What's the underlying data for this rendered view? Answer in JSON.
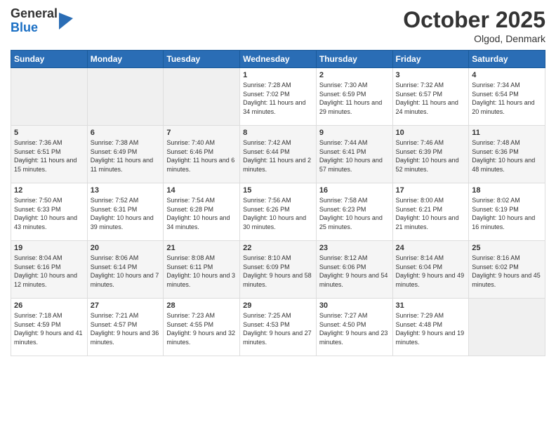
{
  "logo": {
    "general": "General",
    "blue": "Blue"
  },
  "header": {
    "month": "October 2025",
    "location": "Olgod, Denmark"
  },
  "weekdays": [
    "Sunday",
    "Monday",
    "Tuesday",
    "Wednesday",
    "Thursday",
    "Friday",
    "Saturday"
  ],
  "weeks": [
    [
      {
        "day": "",
        "sunrise": "",
        "sunset": "",
        "daylight": ""
      },
      {
        "day": "",
        "sunrise": "",
        "sunset": "",
        "daylight": ""
      },
      {
        "day": "",
        "sunrise": "",
        "sunset": "",
        "daylight": ""
      },
      {
        "day": "1",
        "sunrise": "Sunrise: 7:28 AM",
        "sunset": "Sunset: 7:02 PM",
        "daylight": "Daylight: 11 hours and 34 minutes."
      },
      {
        "day": "2",
        "sunrise": "Sunrise: 7:30 AM",
        "sunset": "Sunset: 6:59 PM",
        "daylight": "Daylight: 11 hours and 29 minutes."
      },
      {
        "day": "3",
        "sunrise": "Sunrise: 7:32 AM",
        "sunset": "Sunset: 6:57 PM",
        "daylight": "Daylight: 11 hours and 24 minutes."
      },
      {
        "day": "4",
        "sunrise": "Sunrise: 7:34 AM",
        "sunset": "Sunset: 6:54 PM",
        "daylight": "Daylight: 11 hours and 20 minutes."
      }
    ],
    [
      {
        "day": "5",
        "sunrise": "Sunrise: 7:36 AM",
        "sunset": "Sunset: 6:51 PM",
        "daylight": "Daylight: 11 hours and 15 minutes."
      },
      {
        "day": "6",
        "sunrise": "Sunrise: 7:38 AM",
        "sunset": "Sunset: 6:49 PM",
        "daylight": "Daylight: 11 hours and 11 minutes."
      },
      {
        "day": "7",
        "sunrise": "Sunrise: 7:40 AM",
        "sunset": "Sunset: 6:46 PM",
        "daylight": "Daylight: 11 hours and 6 minutes."
      },
      {
        "day": "8",
        "sunrise": "Sunrise: 7:42 AM",
        "sunset": "Sunset: 6:44 PM",
        "daylight": "Daylight: 11 hours and 2 minutes."
      },
      {
        "day": "9",
        "sunrise": "Sunrise: 7:44 AM",
        "sunset": "Sunset: 6:41 PM",
        "daylight": "Daylight: 10 hours and 57 minutes."
      },
      {
        "day": "10",
        "sunrise": "Sunrise: 7:46 AM",
        "sunset": "Sunset: 6:39 PM",
        "daylight": "Daylight: 10 hours and 52 minutes."
      },
      {
        "day": "11",
        "sunrise": "Sunrise: 7:48 AM",
        "sunset": "Sunset: 6:36 PM",
        "daylight": "Daylight: 10 hours and 48 minutes."
      }
    ],
    [
      {
        "day": "12",
        "sunrise": "Sunrise: 7:50 AM",
        "sunset": "Sunset: 6:33 PM",
        "daylight": "Daylight: 10 hours and 43 minutes."
      },
      {
        "day": "13",
        "sunrise": "Sunrise: 7:52 AM",
        "sunset": "Sunset: 6:31 PM",
        "daylight": "Daylight: 10 hours and 39 minutes."
      },
      {
        "day": "14",
        "sunrise": "Sunrise: 7:54 AM",
        "sunset": "Sunset: 6:28 PM",
        "daylight": "Daylight: 10 hours and 34 minutes."
      },
      {
        "day": "15",
        "sunrise": "Sunrise: 7:56 AM",
        "sunset": "Sunset: 6:26 PM",
        "daylight": "Daylight: 10 hours and 30 minutes."
      },
      {
        "day": "16",
        "sunrise": "Sunrise: 7:58 AM",
        "sunset": "Sunset: 6:23 PM",
        "daylight": "Daylight: 10 hours and 25 minutes."
      },
      {
        "day": "17",
        "sunrise": "Sunrise: 8:00 AM",
        "sunset": "Sunset: 6:21 PM",
        "daylight": "Daylight: 10 hours and 21 minutes."
      },
      {
        "day": "18",
        "sunrise": "Sunrise: 8:02 AM",
        "sunset": "Sunset: 6:19 PM",
        "daylight": "Daylight: 10 hours and 16 minutes."
      }
    ],
    [
      {
        "day": "19",
        "sunrise": "Sunrise: 8:04 AM",
        "sunset": "Sunset: 6:16 PM",
        "daylight": "Daylight: 10 hours and 12 minutes."
      },
      {
        "day": "20",
        "sunrise": "Sunrise: 8:06 AM",
        "sunset": "Sunset: 6:14 PM",
        "daylight": "Daylight: 10 hours and 7 minutes."
      },
      {
        "day": "21",
        "sunrise": "Sunrise: 8:08 AM",
        "sunset": "Sunset: 6:11 PM",
        "daylight": "Daylight: 10 hours and 3 minutes."
      },
      {
        "day": "22",
        "sunrise": "Sunrise: 8:10 AM",
        "sunset": "Sunset: 6:09 PM",
        "daylight": "Daylight: 9 hours and 58 minutes."
      },
      {
        "day": "23",
        "sunrise": "Sunrise: 8:12 AM",
        "sunset": "Sunset: 6:06 PM",
        "daylight": "Daylight: 9 hours and 54 minutes."
      },
      {
        "day": "24",
        "sunrise": "Sunrise: 8:14 AM",
        "sunset": "Sunset: 6:04 PM",
        "daylight": "Daylight: 9 hours and 49 minutes."
      },
      {
        "day": "25",
        "sunrise": "Sunrise: 8:16 AM",
        "sunset": "Sunset: 6:02 PM",
        "daylight": "Daylight: 9 hours and 45 minutes."
      }
    ],
    [
      {
        "day": "26",
        "sunrise": "Sunrise: 7:18 AM",
        "sunset": "Sunset: 4:59 PM",
        "daylight": "Daylight: 9 hours and 41 minutes."
      },
      {
        "day": "27",
        "sunrise": "Sunrise: 7:21 AM",
        "sunset": "Sunset: 4:57 PM",
        "daylight": "Daylight: 9 hours and 36 minutes."
      },
      {
        "day": "28",
        "sunrise": "Sunrise: 7:23 AM",
        "sunset": "Sunset: 4:55 PM",
        "daylight": "Daylight: 9 hours and 32 minutes."
      },
      {
        "day": "29",
        "sunrise": "Sunrise: 7:25 AM",
        "sunset": "Sunset: 4:53 PM",
        "daylight": "Daylight: 9 hours and 27 minutes."
      },
      {
        "day": "30",
        "sunrise": "Sunrise: 7:27 AM",
        "sunset": "Sunset: 4:50 PM",
        "daylight": "Daylight: 9 hours and 23 minutes."
      },
      {
        "day": "31",
        "sunrise": "Sunrise: 7:29 AM",
        "sunset": "Sunset: 4:48 PM",
        "daylight": "Daylight: 9 hours and 19 minutes."
      },
      {
        "day": "",
        "sunrise": "",
        "sunset": "",
        "daylight": ""
      }
    ]
  ]
}
